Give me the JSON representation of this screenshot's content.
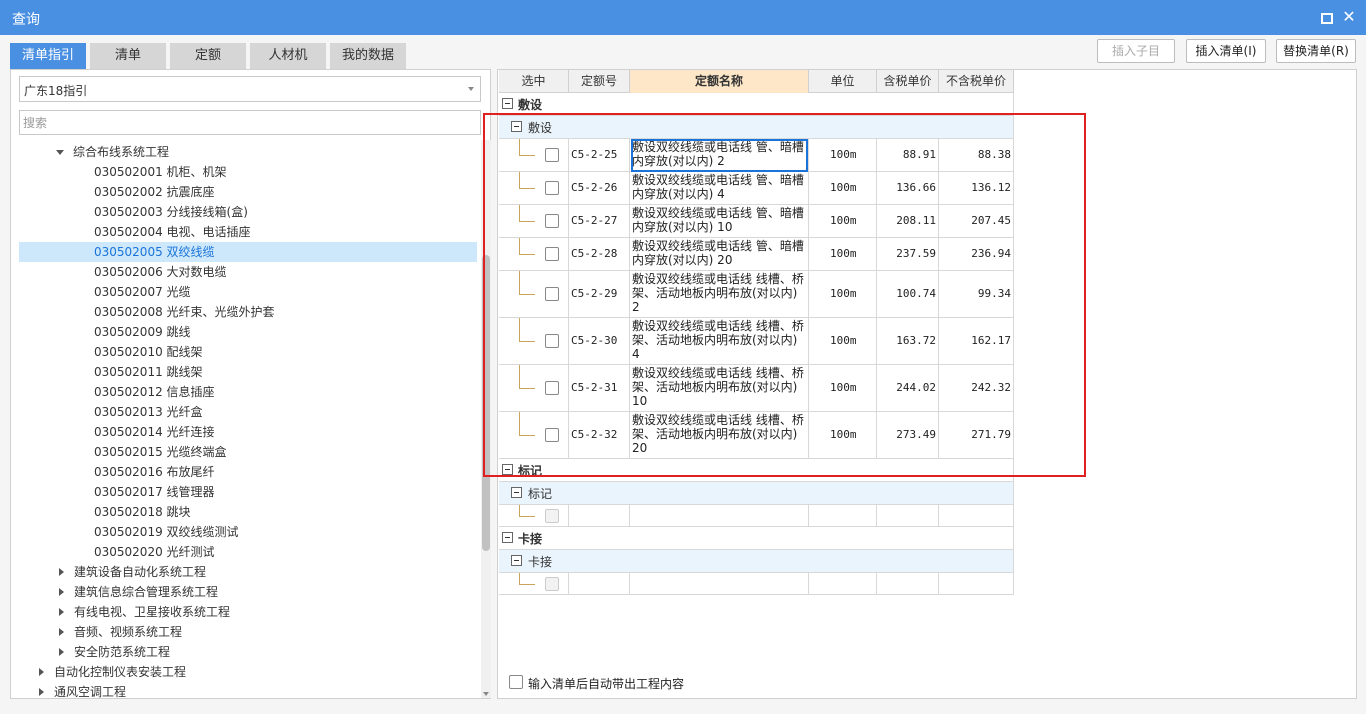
{
  "window": {
    "title": "查询",
    "maximize_icon": "maximize-icon",
    "close_icon": "close-icon",
    "close_glyph": "✕"
  },
  "tabs": [
    "清单指引",
    "清单",
    "定额",
    "人材机",
    "我的数据"
  ],
  "top_buttons": {
    "insert_child": "插入子目",
    "insert_list": "插入清单(I)",
    "replace_list": "替换清单(R)"
  },
  "left": {
    "combo_value": "广东18指引",
    "search_placeholder": "搜索",
    "tree": [
      "综合布线系统工程",
      "030502001  机柜、机架",
      "030502002  抗震底座",
      "030502003  分线接线箱(盒)",
      "030502004  电视、电话插座",
      "030502005  双绞线缆",
      "030502006  大对数电缆",
      "030502007  光缆",
      "030502008  光纤束、光缆外护套",
      "030502009  跳线",
      "030502010  配线架",
      "030502011  跳线架",
      "030502012  信息插座",
      "030502013  光纤盒",
      "030502014  光纤连接",
      "030502015  光缆终端盒",
      "030502016  布放尾纤",
      "030502017  线管理器",
      "030502018  跳块",
      "030502019  双绞线缆测试",
      "030502020  光纤测试",
      "建筑设备自动化系统工程",
      "建筑信息综合管理系统工程",
      "有线电视、卫星接收系统工程",
      "音频、视频系统工程",
      "安全防范系统工程",
      "自动化控制仪表安装工程",
      "通风空调工程"
    ]
  },
  "grid": {
    "headers": [
      "选中",
      "定额号",
      "定额名称",
      "单位",
      "含税单价",
      "不含税单价"
    ],
    "groups": [
      {
        "title": "敷设",
        "sub": "敷设"
      },
      {
        "title": "标记",
        "sub": "标记"
      },
      {
        "title": "卡接",
        "sub": "卡接"
      }
    ],
    "rows": [
      {
        "code": "C5-2-25",
        "name": "敷设双绞线缆或电话线 管、暗槽内穿放(对以内) 2",
        "unit": "100m",
        "price_tax": "88.91",
        "price_notax": "88.38"
      },
      {
        "code": "C5-2-26",
        "name": "敷设双绞线缆或电话线 管、暗槽内穿放(对以内) 4",
        "unit": "100m",
        "price_tax": "136.66",
        "price_notax": "136.12"
      },
      {
        "code": "C5-2-27",
        "name": "敷设双绞线缆或电话线 管、暗槽内穿放(对以内) 10",
        "unit": "100m",
        "price_tax": "208.11",
        "price_notax": "207.45"
      },
      {
        "code": "C5-2-28",
        "name": "敷设双绞线缆或电话线 管、暗槽内穿放(对以内) 20",
        "unit": "100m",
        "price_tax": "237.59",
        "price_notax": "236.94"
      },
      {
        "code": "C5-2-29",
        "name": "敷设双绞线缆或电话线 线槽、桥架、活动地板内明布放(对以内) 2",
        "unit": "100m",
        "price_tax": "100.74",
        "price_notax": "99.34"
      },
      {
        "code": "C5-2-30",
        "name": "敷设双绞线缆或电话线 线槽、桥架、活动地板内明布放(对以内) 4",
        "unit": "100m",
        "price_tax": "163.72",
        "price_notax": "162.17"
      },
      {
        "code": "C5-2-31",
        "name": "敷设双绞线缆或电话线 线槽、桥架、活动地板内明布放(对以内) 10",
        "unit": "100m",
        "price_tax": "244.02",
        "price_notax": "242.32"
      },
      {
        "code": "C5-2-32",
        "name": "敷设双绞线缆或电话线 线槽、桥架、活动地板内明布放(对以内) 20",
        "unit": "100m",
        "price_tax": "273.49",
        "price_notax": "271.79"
      }
    ]
  },
  "bottom": {
    "auto_content_label": "输入清单后自动带出工程内容"
  },
  "colors": {
    "accent": "#4a90e2",
    "selected_bg": "#cde8fb",
    "highlight_box": "#e02020"
  }
}
